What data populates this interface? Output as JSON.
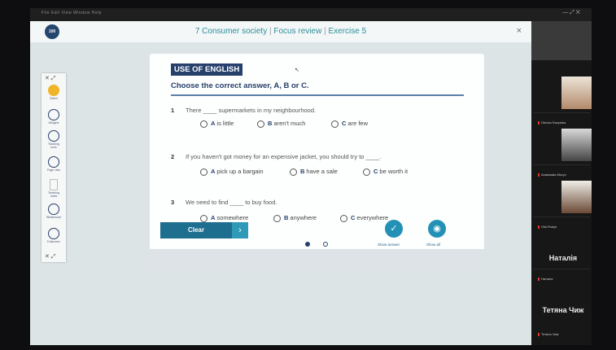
{
  "menubar": {
    "menus": "File   Edit   View   Window   Help",
    "window_controls": "—   ⤢   ✕"
  },
  "app": {
    "logo": "100",
    "title_parts": [
      "7 Consumer society",
      "Focus review",
      "Exercise 5"
    ],
    "close": "×"
  },
  "toolbar": {
    "top_controls": "✕  ⤢",
    "bottom_controls": "✕  ⤢",
    "tools": [
      {
        "label": "Select"
      },
      {
        "label": "Widgets"
      },
      {
        "label": "Teaching tools"
      },
      {
        "label": "Page view"
      },
      {
        "label": "Teaching notes"
      },
      {
        "label": "Whiteboard"
      },
      {
        "label": "Fullscreen"
      }
    ]
  },
  "exercise": {
    "header": "USE OF ENGLISH",
    "instruction": "Choose the correct answer, A, B or C.",
    "questions": [
      {
        "num": "1",
        "text": "There ____ supermarkets in my neighbourhood.",
        "options": [
          {
            "letter": "A",
            "text": "is little"
          },
          {
            "letter": "B",
            "text": "aren't much"
          },
          {
            "letter": "C",
            "text": "are few"
          }
        ]
      },
      {
        "num": "2",
        "text": "If you haven't got money for an expensive jacket, you should try to ____.",
        "options": [
          {
            "letter": "A",
            "text": "pick up a bargain"
          },
          {
            "letter": "B",
            "text": "have a sale"
          },
          {
            "letter": "C",
            "text": "be worth it"
          }
        ]
      },
      {
        "num": "3",
        "text": "We need to find ____ to buy food.",
        "options": [
          {
            "letter": "A",
            "text": "somewhere"
          },
          {
            "letter": "B",
            "text": "anywhere"
          },
          {
            "letter": "C",
            "text": "everywhere"
          }
        ]
      }
    ],
    "clear_label": "Clear",
    "next_arrow": "›",
    "show_answer_label": "Show answer",
    "show_all_label": "Show all",
    "pages": {
      "current": 1,
      "total": 2
    }
  },
  "participants": [
    {
      "name": "Olenka Savytska",
      "has_video": true
    },
    {
      "name": "Anastasiia Muryn",
      "has_video": true
    },
    {
      "name": "Vita Rodyk",
      "has_video": true
    },
    {
      "name": "Наталія",
      "display": "Наталія",
      "has_video": false
    },
    {
      "name": "Тетяна Чиж",
      "display": "Тетяна Чиж",
      "has_video": false
    }
  ],
  "colors": {
    "accent": "#27406b",
    "teal": "#2b8d9c",
    "button": "#1d6e8f"
  }
}
